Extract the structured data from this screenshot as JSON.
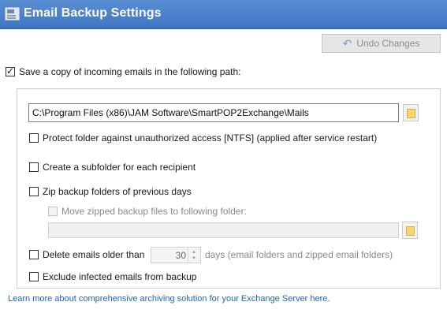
{
  "header": {
    "title": "Email Backup Settings",
    "icon": "settings-window-icon"
  },
  "toolbar": {
    "undo_label": "Undo Changes",
    "undo_icon": "undo-arrow-icon"
  },
  "save_copy": {
    "label": "Save a copy of incoming emails in the following path:",
    "checked": true
  },
  "path": {
    "value": "C:\\Program Files (x86)\\JAM Software\\SmartPOP2Exchange\\Mails"
  },
  "options": {
    "protect": {
      "label": "Protect folder against unauthorized access [NTFS] (applied after service restart)",
      "checked": false
    },
    "subfolder": {
      "label": "Create a subfolder for each recipient",
      "checked": false
    },
    "zip": {
      "label": "Zip backup folders of previous days",
      "checked": false
    },
    "move_zipped": {
      "label": "Move zipped backup files to following folder:",
      "checked": false,
      "enabled": false
    },
    "move_path": {
      "value": ""
    },
    "delete_older": {
      "label": "Delete emails older than",
      "checked": false,
      "days": "30",
      "days_suffix": "days (email folders and zipped email folders)"
    },
    "exclude_infected": {
      "label": "Exclude infected emails from backup",
      "checked": false
    }
  },
  "footer": {
    "link": "Learn more about comprehensive archiving solution for your Exchange Server here."
  },
  "colors": {
    "header_bg": "#4a82cc",
    "link": "#1f64c8",
    "folder": "#f7d76b"
  }
}
